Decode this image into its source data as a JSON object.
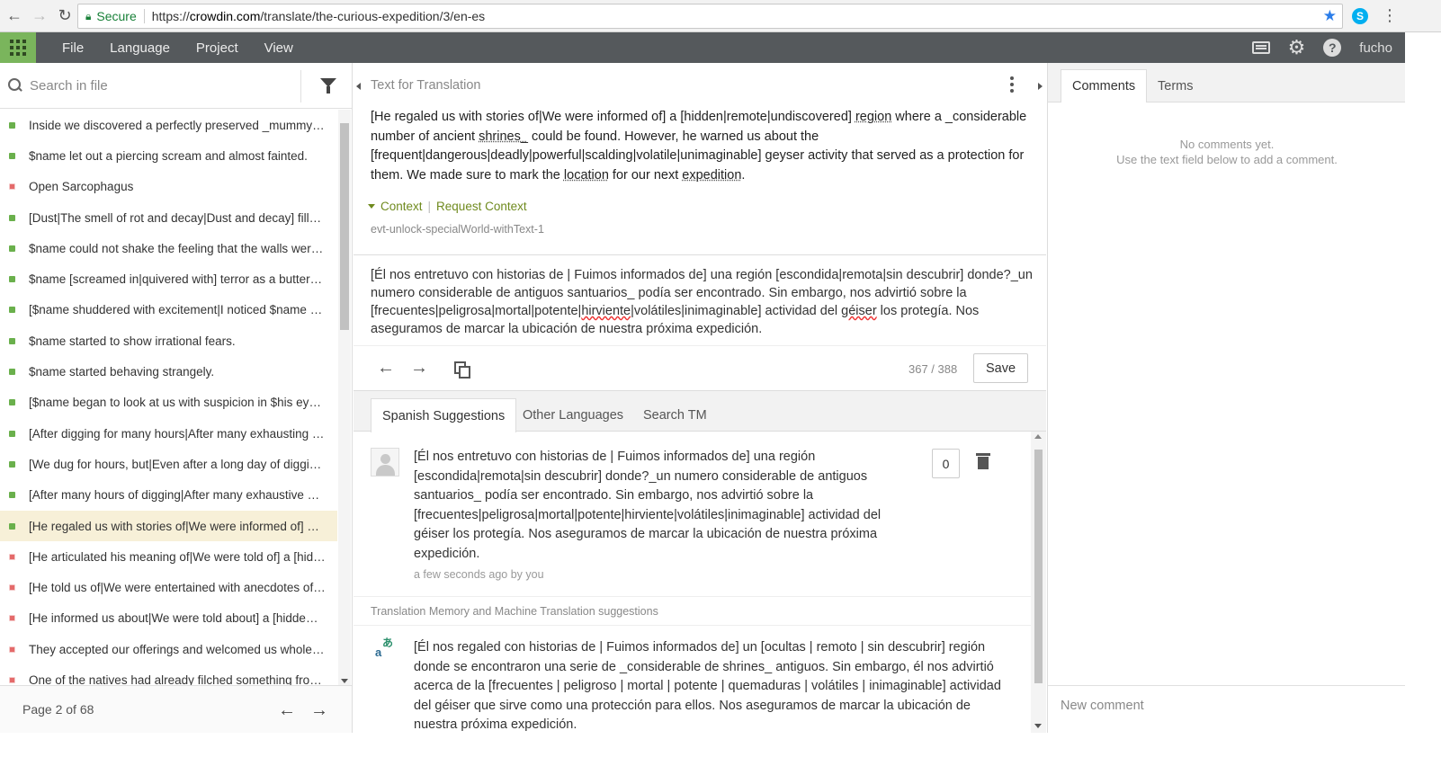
{
  "browser": {
    "secure_label": "Secure",
    "url_scheme": "https://",
    "url_host": "crowdin.com",
    "url_path": "/translate/the-curious-expedition/3/en-es"
  },
  "menu": {
    "items": [
      "File",
      "Language",
      "Project",
      "View"
    ],
    "username": "fucho"
  },
  "left_panel": {
    "search_placeholder": "Search in file",
    "strings": [
      {
        "text": "Inside we discovered a perfectly preserved _mummy_.…",
        "status": "ok"
      },
      {
        "text": "$name let out a piercing scream and almost fainted.",
        "status": "ok"
      },
      {
        "text": "Open Sarcophagus",
        "status": "no"
      },
      {
        "text": "[Dust|The smell of rot and decay|Dust and decay] fill…",
        "status": "ok"
      },
      {
        "text": "$name could not shake the feeling that the walls were…",
        "status": "ok"
      },
      {
        "text": "$name [screamed in|quivered with] terror as a butter…",
        "status": "ok"
      },
      {
        "text": "[$name shuddered with excitement|I noticed $name …",
        "status": "ok"
      },
      {
        "text": "$name started to show irrational fears.",
        "status": "ok"
      },
      {
        "text": "$name started behaving strangely.",
        "status": "ok"
      },
      {
        "text": "[$name began to look at us with suspicion in $his eye…",
        "status": "ok"
      },
      {
        "text": "[After digging for many hours|After many exhausting …",
        "status": "ok"
      },
      {
        "text": "[We dug for hours, but|Even after a long day of diggin…",
        "status": "ok"
      },
      {
        "text": "[After many hours of digging|After many exhaustive h…",
        "status": "ok"
      },
      {
        "text": "[He regaled us with stories of|We were informed of] a…",
        "status": "ok",
        "active": true
      },
      {
        "text": "[He articulated his meaning of|We were told of] a [hid…",
        "status": "no"
      },
      {
        "text": "[He told us of|We were entertained with anecdotes of…",
        "status": "no"
      },
      {
        "text": "[He informed us about|We were told about] a [hidde…",
        "status": "no"
      },
      {
        "text": "They accepted our offerings and welcomed us wholeh…",
        "status": "no"
      },
      {
        "text": "One of the natives had already filched something fro…",
        "status": "no"
      }
    ],
    "page_label": "Page 2 of 68"
  },
  "middle_panel": {
    "section_title": "Text for Translation",
    "source": {
      "p1": "[He regaled us with stories of|We were informed of] a [hidden|remote|undiscovered] ",
      "w_region": "region",
      "p2": " where a _considerable number of ancient ",
      "w_shrines": "shrines_",
      "p3": " could be found. However, he warned us about the [frequent|dangerous|deadly|powerful|scalding|volatile|unimaginable] geyser activity that served as a protection for them. We made sure to mark the ",
      "w_location": "location",
      "p4": " for our next ",
      "w_expedition": "expedition",
      "p5": "."
    },
    "context_label": "Context",
    "request_context_label": "Request Context",
    "string_key": "evt-unlock-specialWorld-withText-1",
    "translation": {
      "t1": "[Él nos entretuvo con historias de | Fuimos informados de] una región [escondida|remota|sin descubrir] donde?_un numero considerable de antiguos santuarios_ podía ser encontrado. Sin embargo, nos advirtió sobre la [frecuentes|peligrosa|mortal|potente|",
      "w_hirviente": "hirviente",
      "t2": "|volátiles|inimaginable] actividad del ",
      "w_geiser": "géiser",
      "t3": " los protegía. Nos aseguramos de marcar la ubicación de nuestra próxima expedición."
    },
    "counter": "367 / 388",
    "save_label": "Save",
    "tabs": [
      "Spanish Suggestions",
      "Other Languages",
      "Search TM"
    ],
    "suggestion": {
      "text": "[Él nos entretuvo con historias de | Fuimos informados de] una región [escondida|remota|sin descubrir] donde?_un numero considerable de antiguos santuarios_ podía ser encontrado. Sin embargo, nos advirtió sobre la [frecuentes|peligrosa|mortal|potente|hirviente|volátiles|inimaginable] actividad del géiser los protegía. Nos aseguramos de marcar la ubicación de nuestra próxima expedición.",
      "meta": "a few seconds ago by you",
      "votes": "0"
    },
    "tm_header": "Translation Memory and Machine Translation suggestions",
    "mt_icon_glyph_a": "a",
    "mt_icon_glyph_b": "あ",
    "mt_suggestion": "[Él nos regaled con historias de | Fuimos informados de] un [ocultas | remoto | sin descubrir] región donde se encontraron una serie de _considerable de shrines_ antiguos. Sin embargo, él nos advirtió acerca de la [frecuentes | peligroso | mortal | potente | quemaduras | volátiles | inimaginable] actividad del géiser que sirve como una protección para ellos. Nos aseguramos de marcar la ubicación de nuestra próxima expedición."
  },
  "right_panel": {
    "tabs": [
      "Comments",
      "Terms"
    ],
    "no_comments_line1": "No comments yet.",
    "no_comments_line2": "Use the text field below to add a comment.",
    "new_comment_placeholder": "New comment"
  },
  "colors": {
    "appbar": "#55595c",
    "grid_button": "#7ab55c",
    "status_ok": "#6ab04c",
    "status_no": "#e46a6a",
    "active_row": "#f7f0d8",
    "context_link": "#6f8a1e"
  }
}
